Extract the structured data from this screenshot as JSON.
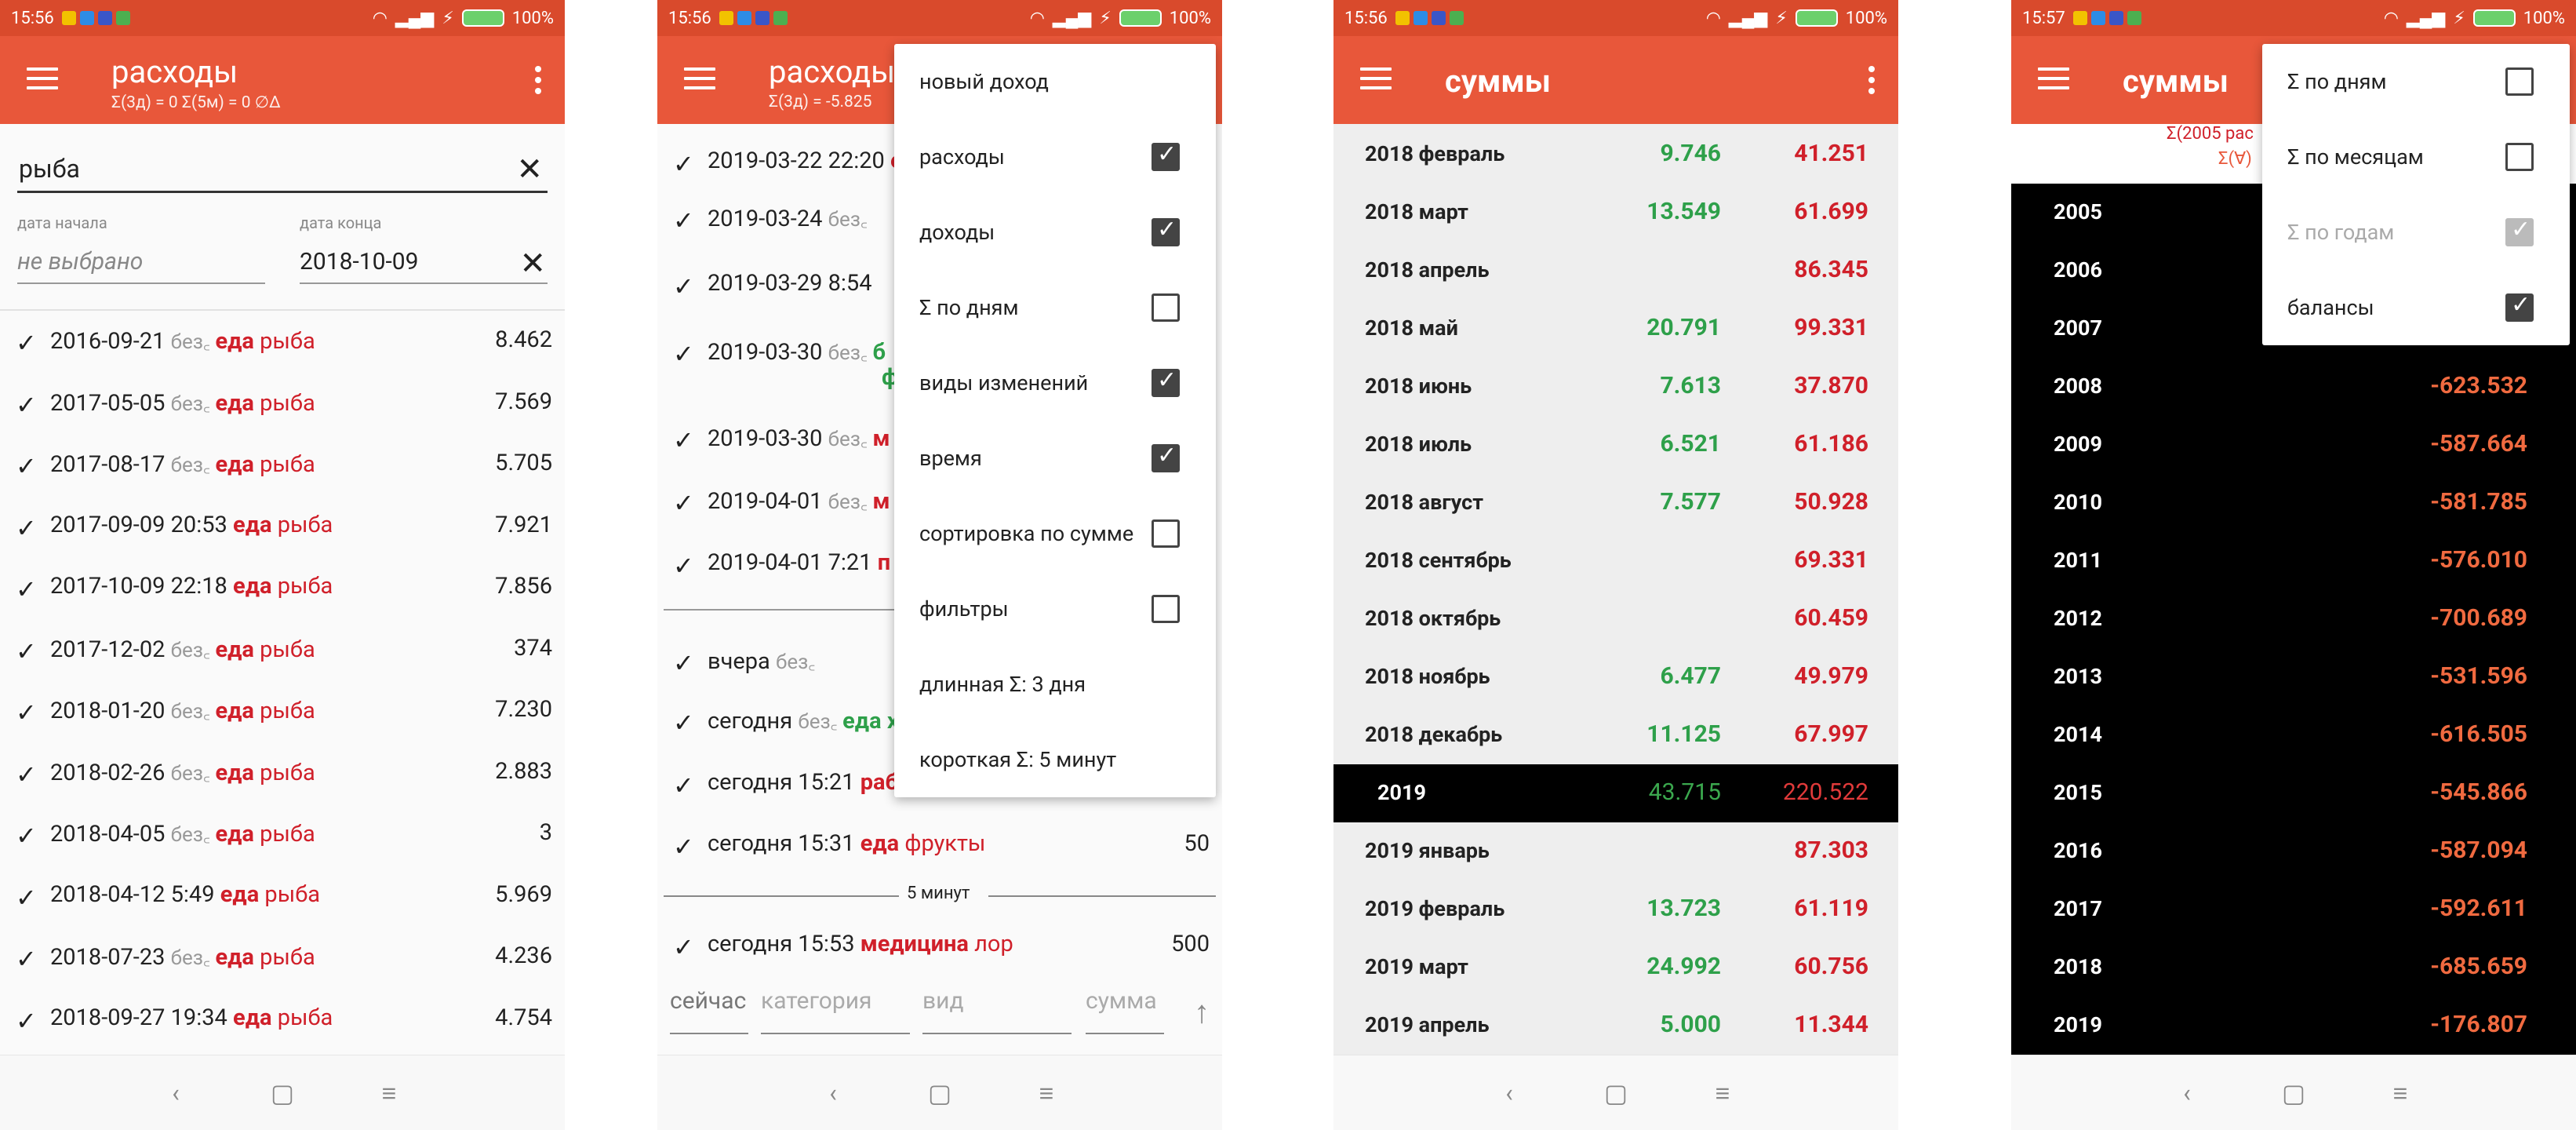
{
  "status": {
    "time1": "15:56",
    "time2": "15:56",
    "time3": "15:56",
    "time4": "15:57",
    "battery": "100%"
  },
  "p1": {
    "title": "расходы",
    "subtitle": "Σ(3д) = 0    Σ(5м) = 0    ∅Δ",
    "search_value": "рыба",
    "date_start_label": "дата начала",
    "date_start_value": "не выбрано",
    "date_end_label": "дата конца",
    "date_end_value": "2018-10-09",
    "rows": [
      {
        "date": "2016-09-21",
        "time": "",
        "noev": "без",
        "cat": "еда",
        "kind": "рыба",
        "amt": "8.462"
      },
      {
        "date": "2017-05-05",
        "time": "",
        "noev": "без",
        "cat": "еда",
        "kind": "рыба",
        "amt": "7.569"
      },
      {
        "date": "2017-08-17",
        "time": "",
        "noev": "без",
        "cat": "еда",
        "kind": "рыба",
        "amt": "5.705"
      },
      {
        "date": "2017-09-09 20:53",
        "time": "",
        "noev": "",
        "cat": "еда",
        "kind": "рыба",
        "amt": "7.921"
      },
      {
        "date": "2017-10-09 22:18",
        "time": "",
        "noev": "",
        "cat": "еда",
        "kind": "рыба",
        "amt": "7.856"
      },
      {
        "date": "2017-12-02",
        "time": "",
        "noev": "без",
        "cat": "еда",
        "kind": "рыба",
        "amt": "374"
      },
      {
        "date": "2018-01-20",
        "time": "",
        "noev": "без",
        "cat": "еда",
        "kind": "рыба",
        "amt": "7.230"
      },
      {
        "date": "2018-02-26",
        "time": "",
        "noev": "без",
        "cat": "еда",
        "kind": "рыба",
        "amt": "2.883"
      },
      {
        "date": "2018-04-05",
        "time": "",
        "noev": "без",
        "cat": "еда",
        "kind": "рыба",
        "amt": "3"
      },
      {
        "date": "2018-04-12 5:49",
        "time": "",
        "noev": "",
        "cat": "еда",
        "kind": "рыба",
        "amt": "5.969"
      },
      {
        "date": "2018-07-23",
        "time": "",
        "noev": "без",
        "cat": "еда",
        "kind": "рыба",
        "amt": "4.236"
      },
      {
        "date": "2018-09-27 19:34",
        "time": "",
        "noev": "",
        "cat": "еда",
        "kind": "рыба",
        "amt": "4.754"
      }
    ]
  },
  "p2": {
    "title": "расходы",
    "subtitle": "Σ(3д) = -5.825",
    "rows": [
      {
        "date": "2019-03-22 22:20",
        "noev": "",
        "cat": "",
        "kind": "",
        "amt": ""
      },
      {
        "date": "2019-03-24",
        "noev": "без",
        "cat": "",
        "kind": "",
        "amt": ""
      },
      {
        "date": "2019-03-29 8:54",
        "noev": "",
        "cat": "",
        "kind": "",
        "amt": ""
      },
      {
        "date": "2019-03-30",
        "noev": "без",
        "cat": "",
        "kind": "",
        "amt": ""
      },
      {
        "date": "2019-03-30",
        "noev": "без",
        "cat": "",
        "kind": "",
        "amt": ""
      },
      {
        "date": "2019-04-01",
        "noev": "без",
        "cat": "",
        "kind": "",
        "amt": ""
      },
      {
        "date": "2019-04-01 7:21",
        "noev": "",
        "cat": "",
        "kind": "",
        "amt": ""
      },
      {
        "date": "вчера",
        "noev": "без",
        "cat": "",
        "kind": "",
        "amt": ""
      },
      {
        "date": "сегодня",
        "noev": "без",
        "cat": "",
        "kind": "",
        "amt": ""
      },
      {
        "date": "сегодня 15:21",
        "noev": "",
        "cat": "",
        "kind": "",
        "amt": ""
      },
      {
        "date": "сегодня 15:31",
        "noev": "",
        "cat": "еда",
        "kind": "фрукты",
        "amt": "50"
      },
      {
        "date": "сегодня 15:53",
        "noev": "",
        "cat": "медицина",
        "kind": "лор",
        "amt": "500"
      }
    ],
    "partial_cats": [
      "е",
      "",
      "",
      "б",
      "м",
      "м",
      "п",
      "",
      "еда х",
      "раб",
      "мед"
    ],
    "green_cont": "ф",
    "sep_label": "5 минут",
    "input_now": "сейчас",
    "input_category": "категория",
    "input_kind": "вид",
    "input_sum": "сумма",
    "menu": [
      {
        "label": "новый доход",
        "check": null
      },
      {
        "label": "расходы",
        "check": true
      },
      {
        "label": "доходы",
        "check": true
      },
      {
        "label": "Σ по дням",
        "check": false
      },
      {
        "label": "виды изменений",
        "check": true
      },
      {
        "label": "время",
        "check": true
      },
      {
        "label": "сортировка по сумме",
        "check": false
      },
      {
        "label": "фильтры",
        "check": false
      },
      {
        "label": "длинная Σ: 3 дня",
        "check": null
      },
      {
        "label": "короткая Σ: 5 минут",
        "check": null
      }
    ]
  },
  "p3": {
    "title": "суммы",
    "rows": [
      {
        "label": "2018 февраль",
        "inc": "9.746",
        "exp": "41.251",
        "year": false
      },
      {
        "label": "2018 март",
        "inc": "13.549",
        "exp": "61.699",
        "year": false
      },
      {
        "label": "2018 апрель",
        "inc": "",
        "exp": "86.345",
        "year": false
      },
      {
        "label": "2018 май",
        "inc": "20.791",
        "exp": "99.331",
        "year": false
      },
      {
        "label": "2018 июнь",
        "inc": "7.613",
        "exp": "37.870",
        "year": false
      },
      {
        "label": "2018 июль",
        "inc": "6.521",
        "exp": "61.186",
        "year": false
      },
      {
        "label": "2018 август",
        "inc": "7.577",
        "exp": "50.928",
        "year": false
      },
      {
        "label": "2018 сентябрь",
        "inc": "",
        "exp": "69.331",
        "year": false
      },
      {
        "label": "2018 октябрь",
        "inc": "",
        "exp": "60.459",
        "year": false
      },
      {
        "label": "2018 ноябрь",
        "inc": "6.477",
        "exp": "49.979",
        "year": false
      },
      {
        "label": "2018 декабрь",
        "inc": "11.125",
        "exp": "67.997",
        "year": false
      },
      {
        "label": "2019",
        "inc": "43.715",
        "exp": "220.522",
        "year": true
      },
      {
        "label": "2019 январь",
        "inc": "",
        "exp": "87.303",
        "year": false
      },
      {
        "label": "2019 февраль",
        "inc": "13.723",
        "exp": "61.119",
        "year": false
      },
      {
        "label": "2019 март",
        "inc": "24.992",
        "exp": "60.756",
        "year": false
      },
      {
        "label": "2019 апрель",
        "inc": "5.000",
        "exp": "11.344",
        "year": false
      }
    ]
  },
  "p4": {
    "title": "суммы",
    "head1": "Σ(2005 рас",
    "head2": "Σ(∀)",
    "rows": [
      {
        "label": "2005",
        "val": ""
      },
      {
        "label": "2006",
        "val": ""
      },
      {
        "label": "2007",
        "val": ""
      },
      {
        "label": "2008",
        "val": "-623.532"
      },
      {
        "label": "2009",
        "val": "-587.664"
      },
      {
        "label": "2010",
        "val": "-581.785"
      },
      {
        "label": "2011",
        "val": "-576.010"
      },
      {
        "label": "2012",
        "val": "-700.689"
      },
      {
        "label": "2013",
        "val": "-531.596"
      },
      {
        "label": "2014",
        "val": "-616.505"
      },
      {
        "label": "2015",
        "val": "-545.866"
      },
      {
        "label": "2016",
        "val": "-587.094"
      },
      {
        "label": "2017",
        "val": "-592.611"
      },
      {
        "label": "2018",
        "val": "-685.659"
      },
      {
        "label": "2019",
        "val": "-176.807"
      }
    ],
    "menu": [
      {
        "label": "Σ по дням",
        "check": false,
        "disabled": false
      },
      {
        "label": "Σ по месяцам",
        "check": false,
        "disabled": false
      },
      {
        "label": "Σ по годам",
        "check": true,
        "disabled": true
      },
      {
        "label": "балансы",
        "check": true,
        "disabled": false
      }
    ]
  },
  "colors": {
    "toolbar": "#e8573a",
    "status": "#d94a2c",
    "expense": "#d0202a",
    "income": "#2ea04a",
    "balance": "#f06a40"
  },
  "nav": {
    "back": "‹",
    "home": "▢",
    "menu": "≡"
  }
}
